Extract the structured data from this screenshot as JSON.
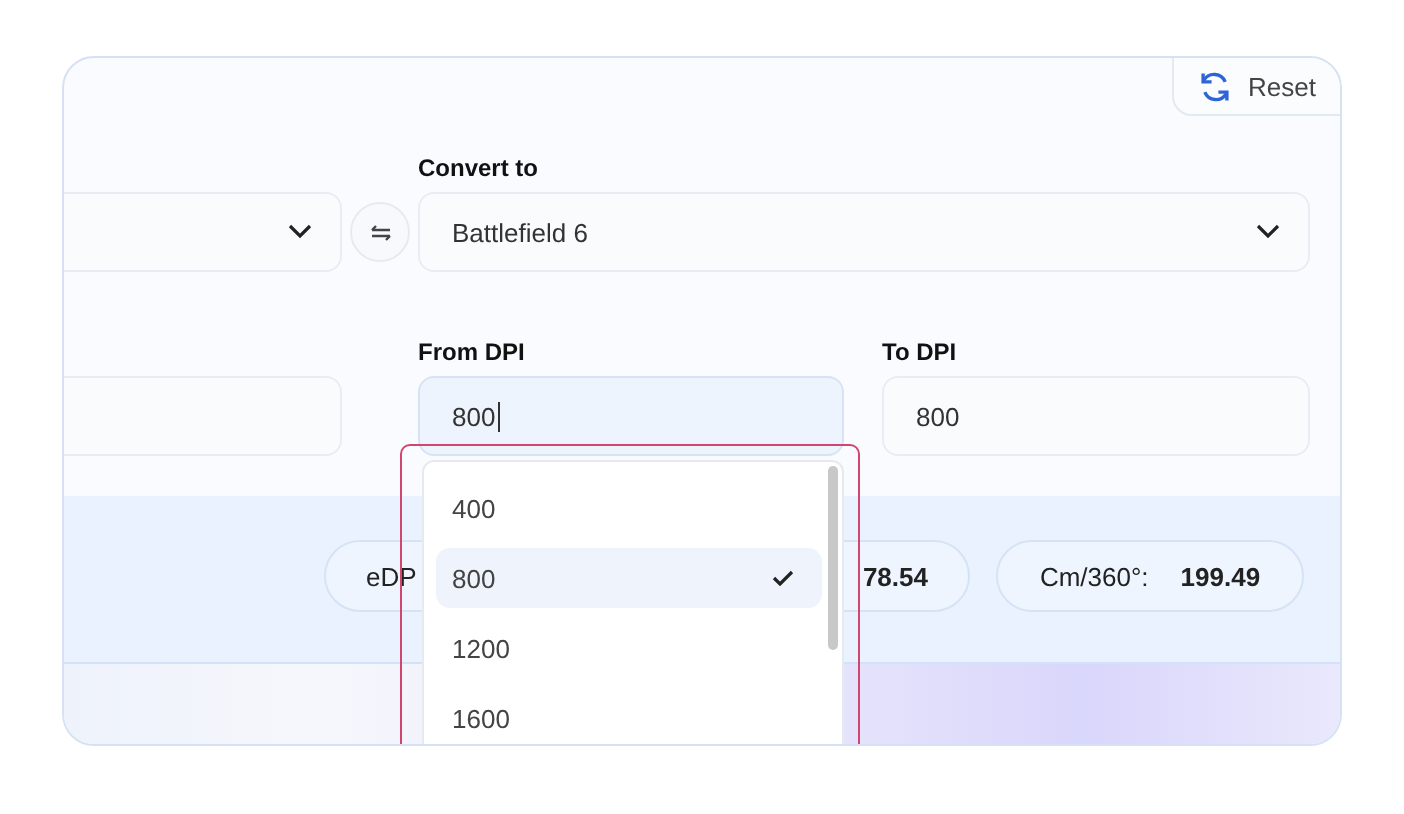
{
  "reset_button": {
    "label": "Reset"
  },
  "convert_to": {
    "label": "Convert to",
    "value": "Battlefield 6"
  },
  "from_dpi": {
    "label": "From DPI",
    "value": "800"
  },
  "to_dpi": {
    "label": "To DPI",
    "value": "800"
  },
  "results": [
    {
      "label": "eDP"
    },
    {
      "value": "78.54"
    },
    {
      "label": "Cm/360°:",
      "value": "199.49"
    }
  ],
  "dpi_dropdown": {
    "options": [
      {
        "label": "400",
        "selected": false
      },
      {
        "label": "800",
        "selected": true
      },
      {
        "label": "1200",
        "selected": false
      },
      {
        "label": "1600",
        "selected": false
      }
    ]
  }
}
